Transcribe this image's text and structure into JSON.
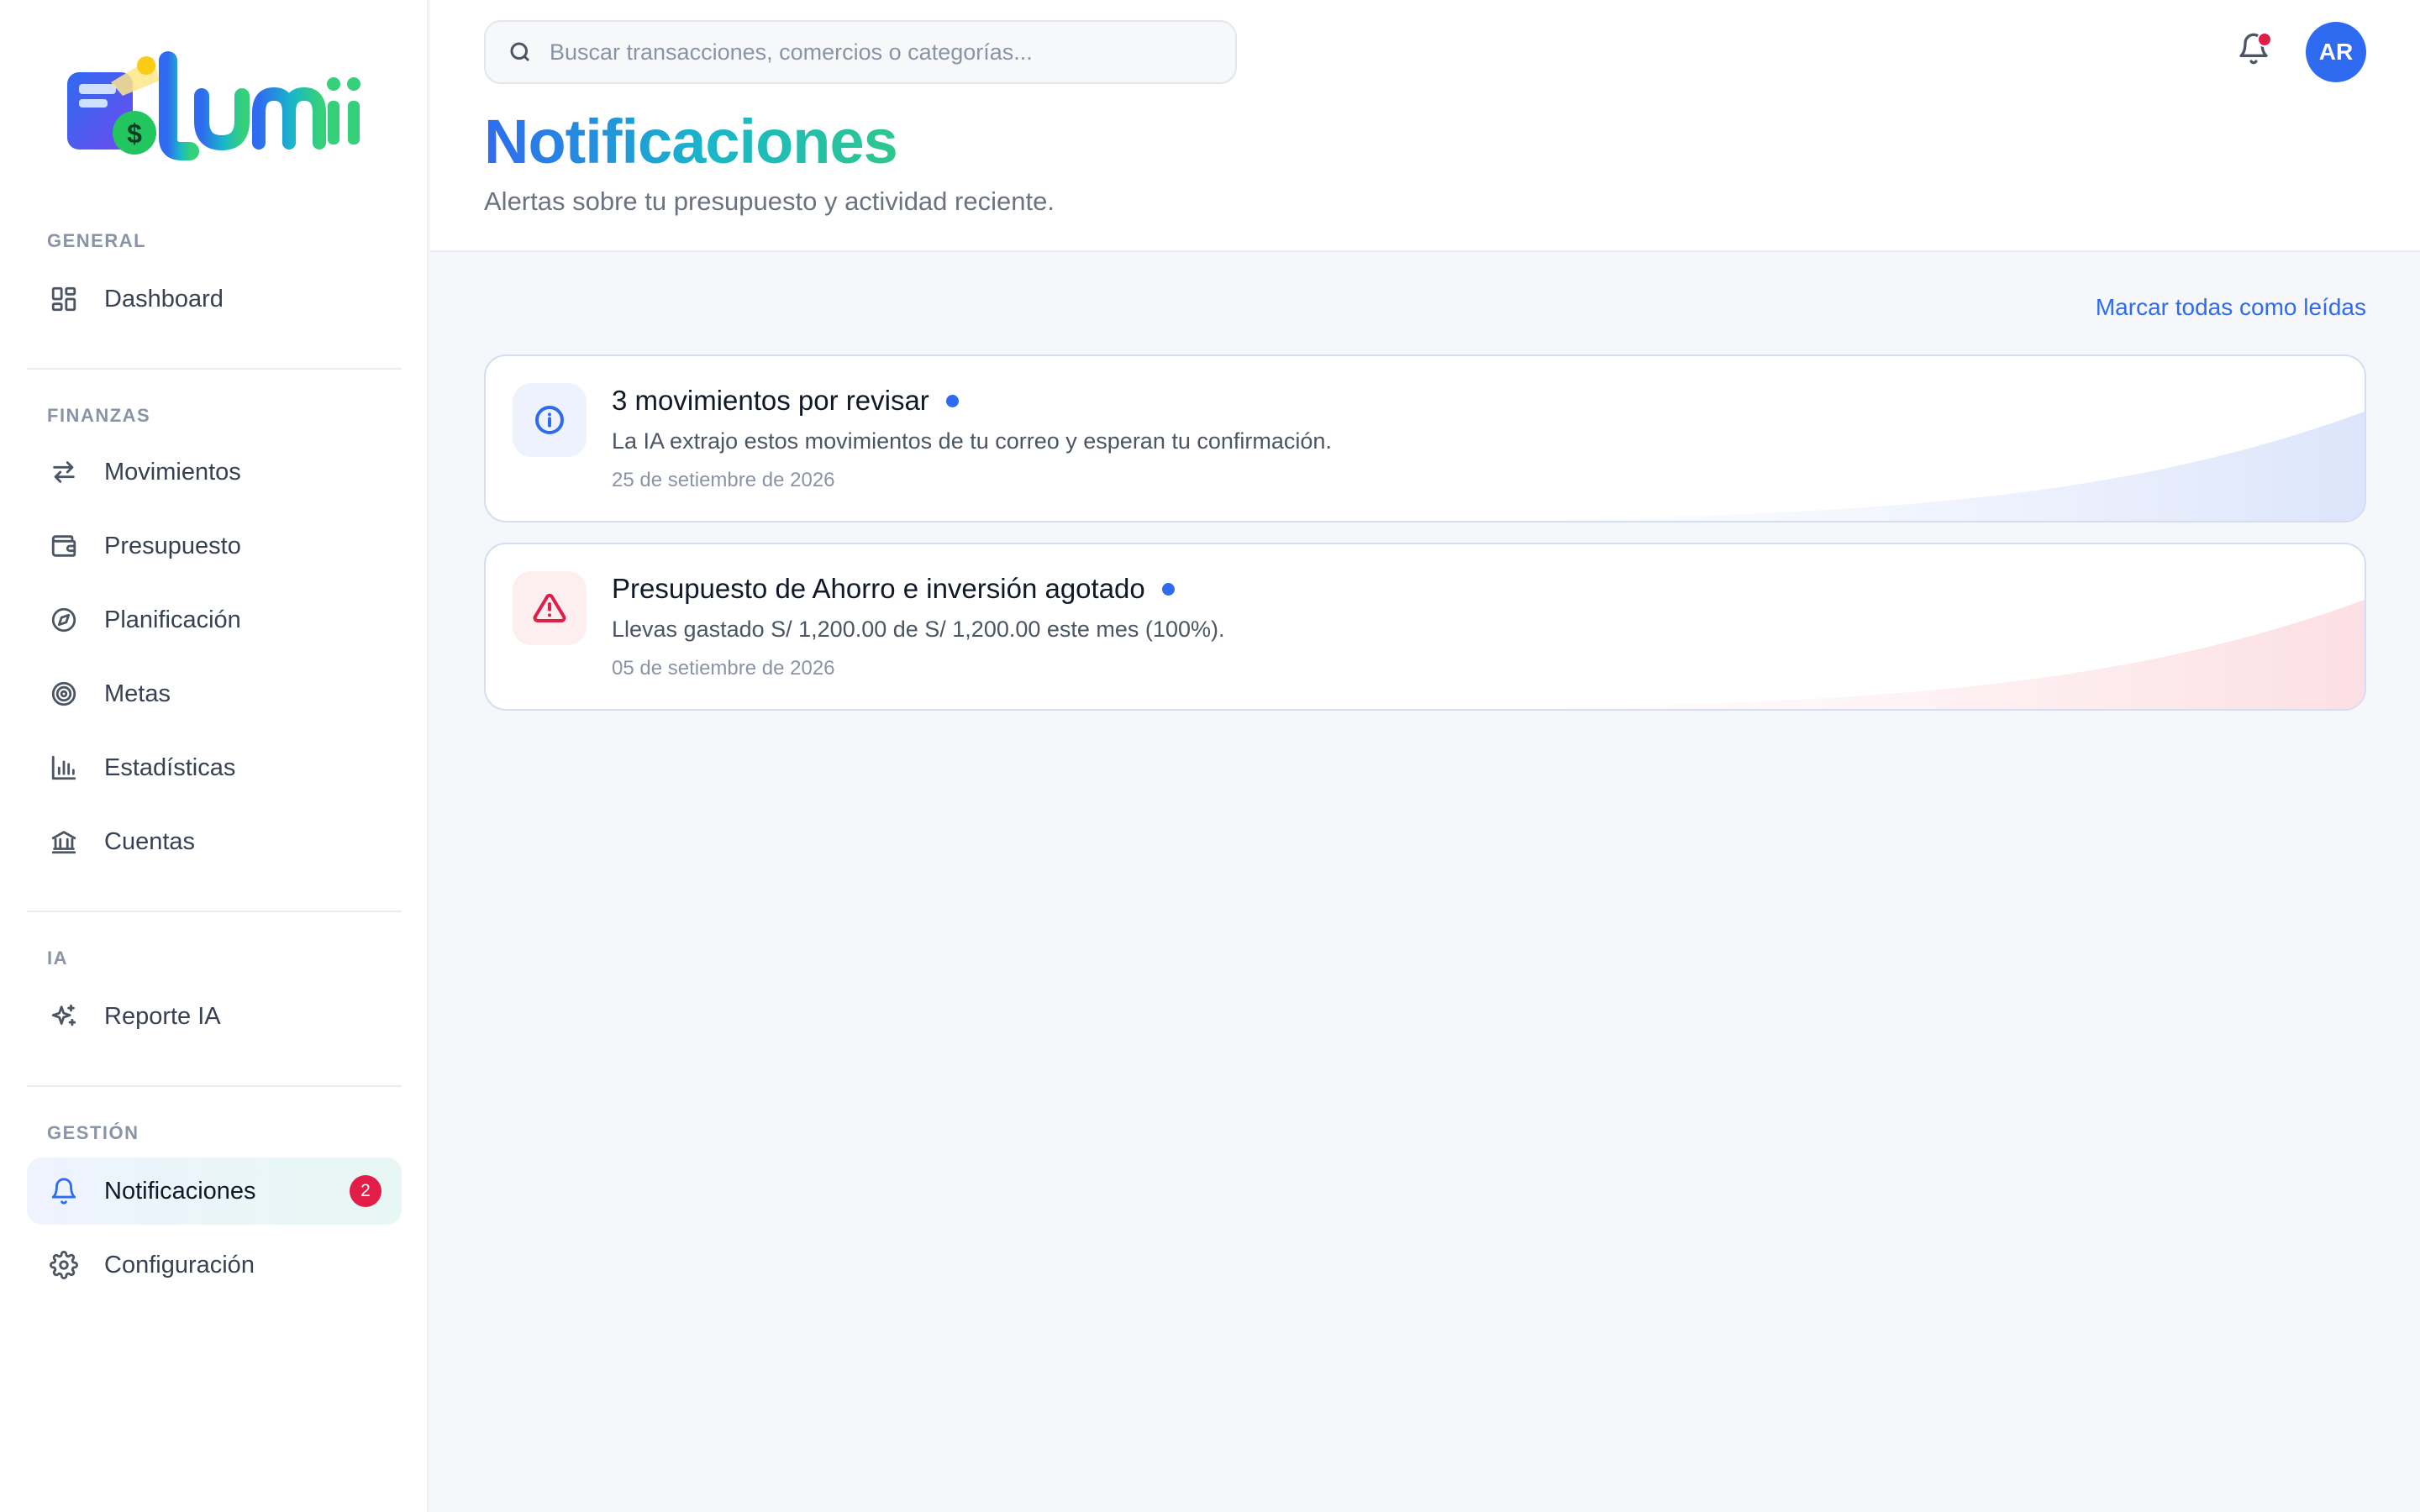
{
  "app": {
    "name": "Lumii"
  },
  "sidebar": {
    "sections": [
      {
        "label": "GENERAL",
        "items": [
          {
            "label": "Dashboard",
            "icon": "grid-icon"
          }
        ]
      },
      {
        "label": "FINANZAS",
        "items": [
          {
            "label": "Movimientos",
            "icon": "arrows-icon"
          },
          {
            "label": "Presupuesto",
            "icon": "wallet-icon"
          },
          {
            "label": "Planificación",
            "icon": "compass-icon"
          },
          {
            "label": "Metas",
            "icon": "target-icon"
          },
          {
            "label": "Estadísticas",
            "icon": "bar-chart-icon"
          },
          {
            "label": "Cuentas",
            "icon": "bank-icon"
          }
        ]
      },
      {
        "label": "IA",
        "items": [
          {
            "label": "Reporte IA",
            "icon": "sparkles-icon"
          }
        ]
      },
      {
        "label": "GESTIÓN",
        "items": [
          {
            "label": "Notificaciones",
            "icon": "bell-icon",
            "active": true,
            "badge": "2"
          },
          {
            "label": "Configuración",
            "icon": "gear-icon"
          }
        ]
      }
    ]
  },
  "header": {
    "search_placeholder": "Buscar transacciones, comercios o categorías...",
    "avatar_initials": "AR",
    "has_unread": true
  },
  "page": {
    "title": "Notificaciones",
    "subtitle": "Alertas sobre tu presupuesto y actividad reciente.",
    "mark_all_label": "Marcar todas como leídas"
  },
  "notifications": [
    {
      "type": "info",
      "title": "3 movimientos por revisar",
      "description": "La IA extrajo estos movimientos de tu correo y esperan tu confirmación.",
      "date": "25 de setiembre de 2026",
      "unread": true
    },
    {
      "type": "warning",
      "title": "Presupuesto de Ahorro e inversión agotado",
      "description": "Llevas gastado S/ 1,200.00 de S/ 1,200.00 este mes (100%).",
      "date": "05 de setiembre de 2026",
      "unread": true
    }
  ],
  "colors": {
    "accent": "#2f6bf0",
    "danger": "#e11d48",
    "brand_teal": "#19b7c9",
    "brand_green": "#2ec78d"
  }
}
